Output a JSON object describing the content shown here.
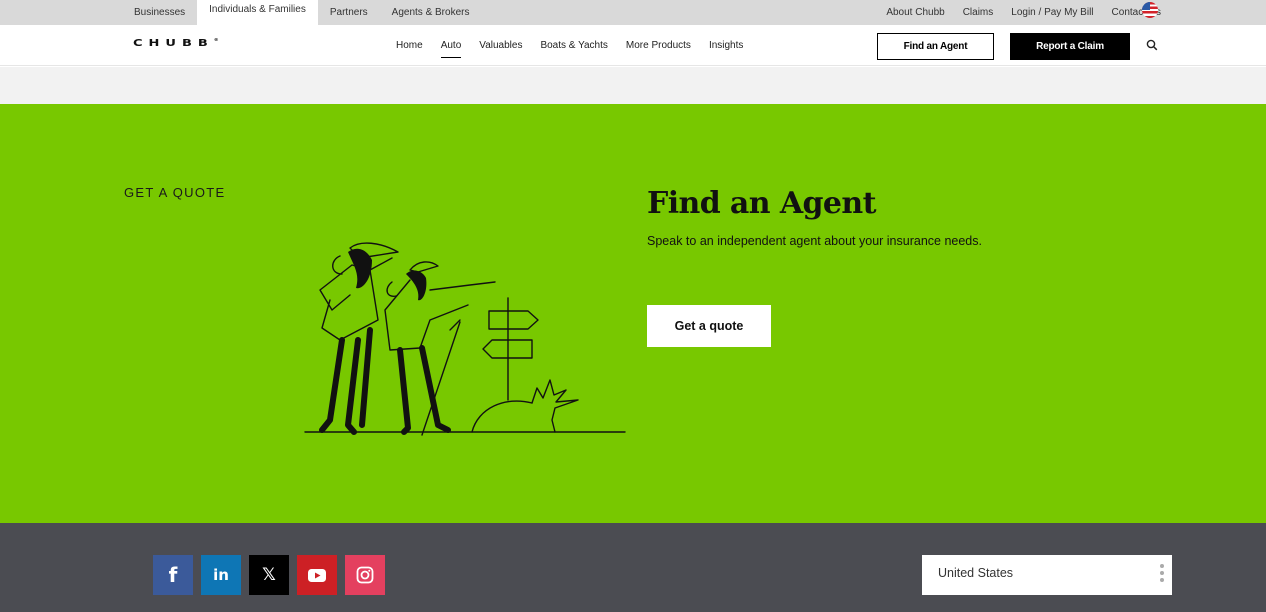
{
  "utility_bar": {
    "segments": [
      {
        "label": "Businesses",
        "active": false
      },
      {
        "label": "Individuals & Families",
        "active": true
      },
      {
        "label": "Partners",
        "active": false
      },
      {
        "label": "Agents & Brokers",
        "active": false
      }
    ],
    "links": [
      "About Chubb",
      "Claims",
      "Login / Pay My Bill",
      "Contact Us"
    ],
    "locale_icon": "us-flag-icon"
  },
  "header": {
    "logo": "CHUBB",
    "logo_mark": "®",
    "nav": [
      {
        "label": "Home",
        "active": false
      },
      {
        "label": "Auto",
        "active": true
      },
      {
        "label": "Valuables",
        "active": false
      },
      {
        "label": "Boats & Yachts",
        "active": false
      },
      {
        "label": "More Products",
        "active": false
      },
      {
        "label": "Insights",
        "active": false
      }
    ],
    "find_agent_label": "Find an Agent",
    "report_claim_label": "Report a Claim",
    "search_icon": "search-icon"
  },
  "hero": {
    "eyebrow": "GET A QUOTE",
    "title": "Find an Agent",
    "subtitle": "Speak to an independent agent about your insurance needs.",
    "cta_label": "Get a quote",
    "illustration": "two hikers pointing toward signpost",
    "background_color": "#78c800"
  },
  "footer": {
    "social": [
      {
        "name": "facebook",
        "glyph": "f",
        "color": "#3b5a9a"
      },
      {
        "name": "linkedin",
        "glyph": "in",
        "color": "#0e76b5"
      },
      {
        "name": "x",
        "glyph": "𝕏",
        "color": "#000000"
      },
      {
        "name": "youtube",
        "glyph": "",
        "color": "#cd2025"
      },
      {
        "name": "instagram",
        "glyph": "",
        "color": "#e4405f"
      }
    ],
    "country_selector": {
      "value": "United States"
    },
    "background_color": "#4b4c52"
  }
}
